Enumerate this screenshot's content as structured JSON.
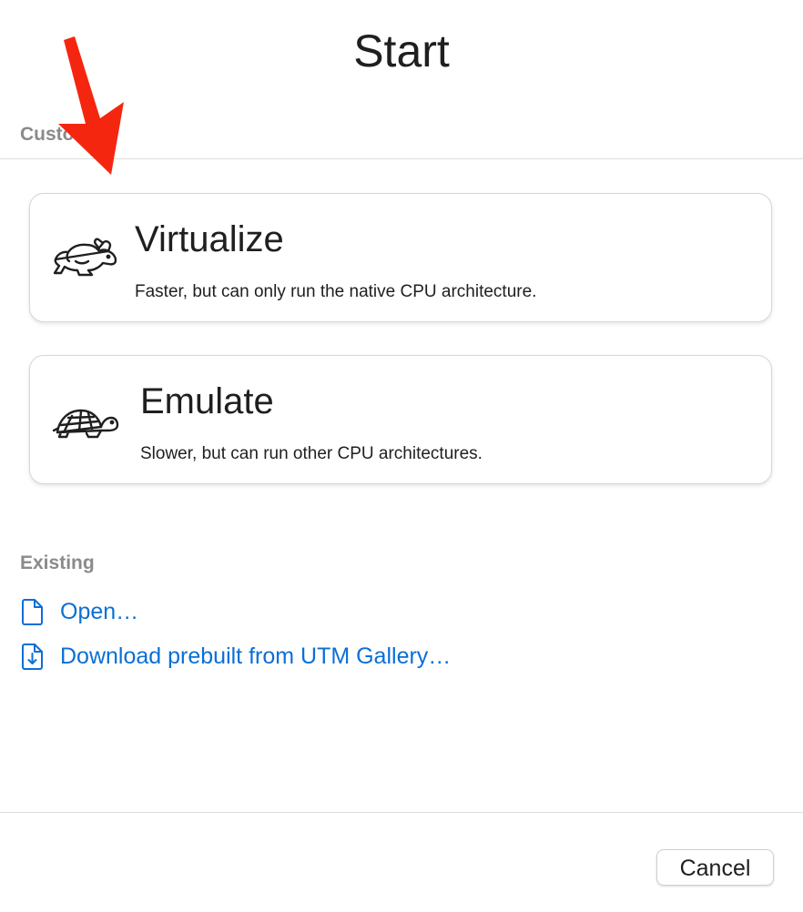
{
  "dialog": {
    "title": "Start"
  },
  "sections": {
    "custom_label": "Custom",
    "existing_label": "Existing"
  },
  "options": [
    {
      "title": "Virtualize",
      "description": "Faster, but can only run the native CPU architecture.",
      "icon": "hare-icon"
    },
    {
      "title": "Emulate",
      "description": "Slower, but can run other CPU architectures.",
      "icon": "tortoise-icon"
    }
  ],
  "existing": {
    "open_label": "Open…",
    "open_icon": "document-icon",
    "gallery_label": "Download prebuilt from UTM Gallery…",
    "gallery_icon": "document-download-icon"
  },
  "footer": {
    "cancel_label": "Cancel"
  },
  "colors": {
    "link": "#0a6fd6",
    "section_label": "#8a8a8a",
    "annotation_arrow": "#f5260f"
  }
}
